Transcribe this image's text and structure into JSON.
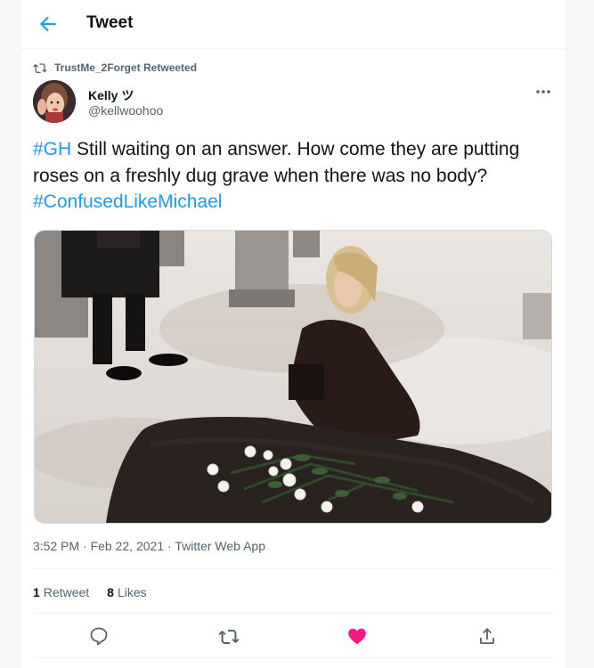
{
  "header": {
    "title": "Tweet"
  },
  "retweet_banner": "TrustMe_2Forget Retweeted",
  "author": {
    "name": "Kelly ツ",
    "handle": "@kellwoohoo"
  },
  "tweet": {
    "hashtag1": "#GH",
    "body": " Still waiting on an answer. How come they are putting roses on a freshly dug grave when there was no body? ",
    "hashtag2": "#ConfusedLikeMichael"
  },
  "meta": {
    "time": "3:52 PM",
    "sep1": " · ",
    "date": "Feb 22, 2021",
    "sep2": " · ",
    "app": "Twitter Web App"
  },
  "stats": {
    "retweets": "1",
    "retweets_label": "Retweet",
    "likes": "8",
    "likes_label": "Likes"
  },
  "colors": {
    "accent": "#1d9bf0",
    "like": "#f91880",
    "muted": "#536471"
  },
  "icons": [
    "back-arrow-icon",
    "retweet-icon",
    "more-icon",
    "reply-icon",
    "like-icon",
    "share-icon"
  ]
}
